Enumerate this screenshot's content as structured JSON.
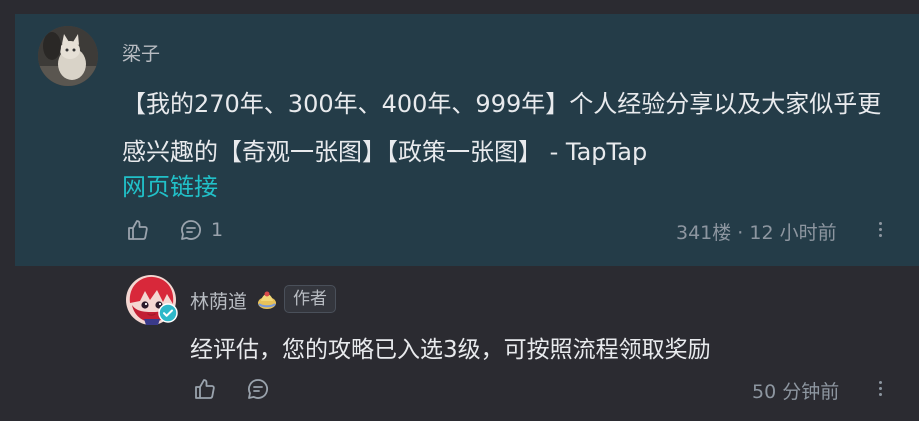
{
  "main_comment": {
    "author": "梁子",
    "body": "【我的270年、300年、400年、999年】个人经验分享以及大家似乎更感兴趣的【奇观一张图】【政策一张图】 - TapTap",
    "link_text": "网页链接",
    "reply_count": "1",
    "floor_time": "341楼 · 12 小时前"
  },
  "reply": {
    "author": "林荫道",
    "badge": "作者",
    "body": "经评估，您的攻略已入选3级，可按照流程领取奖励",
    "time": "50 分钟前"
  },
  "colors": {
    "background": "#2b2b31",
    "highlight_card": "#243c48",
    "link": "#21c0c8",
    "verified_badge": "#2eb8c9"
  }
}
